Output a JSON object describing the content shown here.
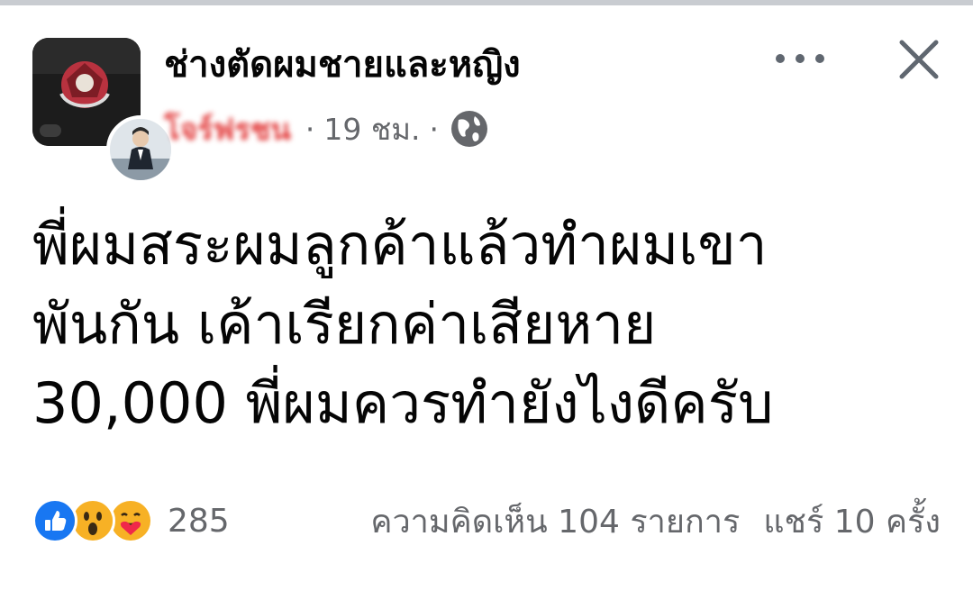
{
  "header": {
    "group_name": "ช่างตัดผมชายและหญิง",
    "author_name": "โจร์ฟรชน",
    "time": "19 ชม.",
    "separator": "·",
    "icons": {
      "group_avatar": "group-avatar-image",
      "user_avatar": "user-avatar-image",
      "audience": "globe-icon",
      "more": "more-options-icon",
      "close": "close-icon"
    }
  },
  "post": {
    "lines": [
      "พี่ผมสระผมลูกค้าแล้วทำผมเขา",
      "พันกัน เค้าเรียกค่าเสียหาย",
      "30,000 พี่ผมควรทำยังไงดีครับ"
    ]
  },
  "footer": {
    "reaction_icons": [
      "like-icon",
      "wow-icon",
      "care-icon"
    ],
    "reaction_count": "285",
    "comments": "ความคิดเห็น 104 รายการ",
    "shares": "แชร์ 10 ครั้ง"
  },
  "colors": {
    "text": "#050505",
    "secondary": "#65676b",
    "like_blue": "#1877f2",
    "reaction_yellow": "#f7b125",
    "redaction_red": "#e23b3b"
  }
}
